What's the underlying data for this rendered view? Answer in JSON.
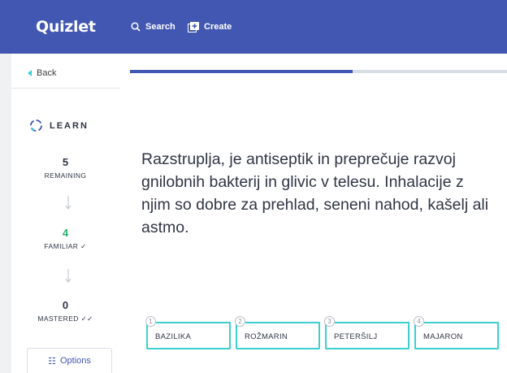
{
  "header": {
    "logo": "Quizlet",
    "search_label": "Search",
    "create_label": "Create",
    "search_icon": "search-icon",
    "create_icon": "create-plus-icon",
    "bar_color": "#4257b2"
  },
  "sidebar": {
    "back_label": "Back",
    "mode_label": "LEARN",
    "remaining": {
      "value": "5",
      "label": "REMAINING"
    },
    "familiar": {
      "value": "4",
      "label": "FAMILIAR ✓"
    },
    "mastered": {
      "value": "0",
      "label": "MASTERED ✓✓"
    },
    "options_label": "Options"
  },
  "progress": {
    "fraction": 0.59
  },
  "question": {
    "prompt": "Razstruplja, je antiseptik in preprečuje razvoj gnilobnih bakterij in glivic v telesu. Inhalacije z njim so dobre za prehlad, seneni nahod, kašelj ali astmo."
  },
  "choices": [
    {
      "number": "1",
      "label": "BAZILIKA"
    },
    {
      "number": "2",
      "label": "ROŽMARIN"
    },
    {
      "number": "3",
      "label": "PETERŠILJ"
    },
    {
      "number": "4",
      "label": "MAJARON"
    }
  ],
  "colors": {
    "accent": "#4257b2",
    "teal": "#3ccfcf",
    "green": "#23b26d"
  }
}
